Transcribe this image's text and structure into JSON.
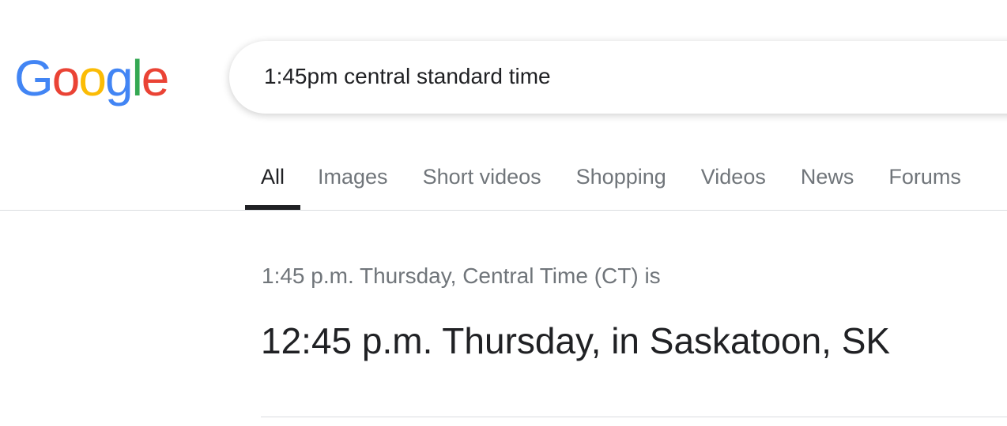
{
  "logo": {
    "text": "Google",
    "letters": [
      "G",
      "o",
      "o",
      "g",
      "l",
      "e"
    ],
    "colors": [
      "#4285f4",
      "#ea4335",
      "#fbbc05",
      "#4285f4",
      "#34a853",
      "#ea4335"
    ]
  },
  "search": {
    "value": "1:45pm central standard time"
  },
  "tabs": [
    {
      "label": "All",
      "active": true
    },
    {
      "label": "Images"
    },
    {
      "label": "Short videos"
    },
    {
      "label": "Shopping"
    },
    {
      "label": "Videos"
    },
    {
      "label": "News"
    },
    {
      "label": "Forums"
    }
  ],
  "result": {
    "question": "1:45 p.m. Thursday, Central Time (CT) is",
    "answer": "12:45 p.m. Thursday, in Saskatoon, SK"
  }
}
